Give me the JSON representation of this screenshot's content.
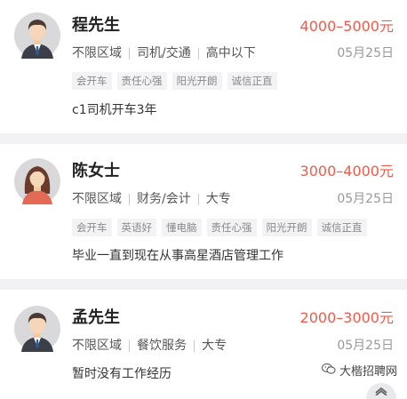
{
  "candidates": [
    {
      "name": "程先生",
      "salary": "4000–5000元",
      "area": "不限区域",
      "job": "司机/交通",
      "education": "高中以下",
      "date": "05月25日",
      "tags": [
        "会开车",
        "责任心强",
        "阳光开朗",
        "诚信正直"
      ],
      "description": "c1司机开车3年",
      "avatar_icon": "male-avatar-icon"
    },
    {
      "name": "陈女士",
      "salary": "3000–4000元",
      "area": "不限区域",
      "job": "财务/会计",
      "education": "大专",
      "date": "05月25日",
      "tags": [
        "会开车",
        "英语好",
        "懂电脑",
        "责任心强",
        "阳光开朗",
        "诚信正直"
      ],
      "description": "毕业一直到现在从事高星酒店管理工作",
      "avatar_icon": "female-avatar-icon"
    },
    {
      "name": "孟先生",
      "salary": "2000–3000元",
      "area": "不限区域",
      "job": "餐饮服务",
      "education": "大专",
      "date": "05月25日",
      "tags": [],
      "description": "暂时没有工作经历",
      "avatar_icon": "male-avatar-icon"
    }
  ],
  "watermark": {
    "text": "大楷招聘网",
    "icon": "wechat-icon"
  },
  "scroll_top": {
    "icon": "chevron-up-icon"
  },
  "colors": {
    "salary": "#f05a4a",
    "background": "#f2f2f5",
    "tag_bg": "#f3f3f6"
  }
}
